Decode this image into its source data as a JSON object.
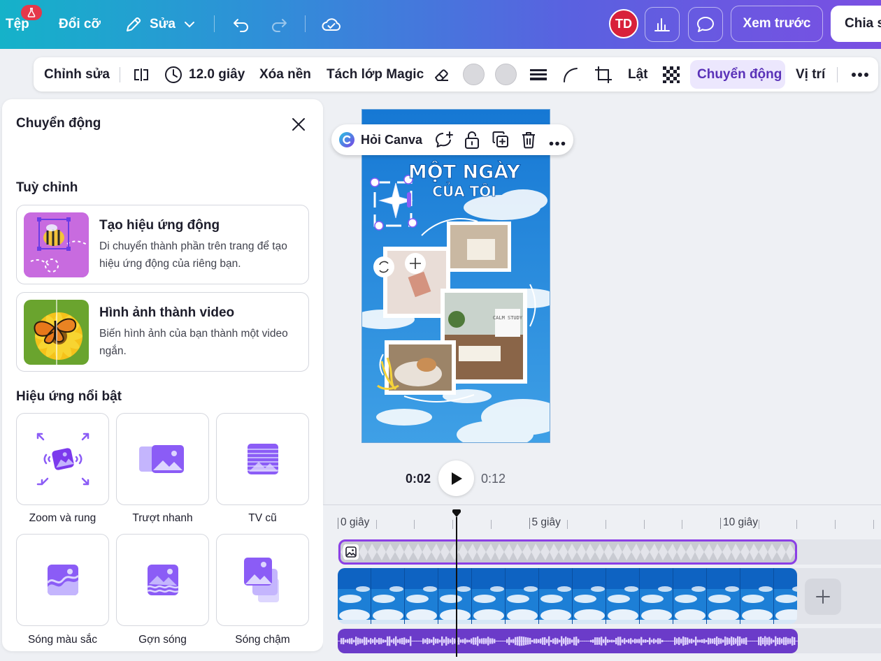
{
  "topbar": {
    "file_label": "Tệp",
    "resize_label": "Đổi cỡ",
    "edit_label": "Sửa",
    "avatar_initials": "TD",
    "preview_label": "Xem trước",
    "share_label": "Chia s"
  },
  "toolbar": {
    "edit_label": "Chỉnh sửa",
    "duration_label": "12.0 giây",
    "remove_bg_label": "Xóa nền",
    "magic_grab_label": "Tách lớp Magic",
    "flip_label": "Lật",
    "animate_label": "Chuyển động",
    "position_label": "Vị trí"
  },
  "panel": {
    "title": "Chuyển động",
    "customize_heading": "Tuỳ chỉnh",
    "cards": [
      {
        "title": "Tạo hiệu ứng động",
        "description": "Di chuyển thành phần trên trang để tạo hiệu ứng động của riêng bạn."
      },
      {
        "title": "Hình ảnh thành video",
        "description": "Biến hình ảnh của bạn thành một video ngắn."
      }
    ],
    "featured_heading": "Hiệu ứng nổi bật",
    "effects": [
      {
        "label": "Zoom và rung",
        "icon": "zoom-shake-icon"
      },
      {
        "label": "Trượt nhanh",
        "icon": "fast-slide-icon"
      },
      {
        "label": "TV cũ",
        "icon": "old-tv-icon"
      },
      {
        "label": "Sóng màu sắc",
        "icon": "color-wave-icon"
      },
      {
        "label": "Gợn sóng",
        "icon": "ripple-icon"
      },
      {
        "label": "Sóng chậm",
        "icon": "slow-wave-icon"
      }
    ]
  },
  "canvas": {
    "ask_canva_label": "Hỏi Canva",
    "design_title_line1": "MỘT NGÀY",
    "design_title_line2": "CỦA TÔI",
    "calm_study_text": "CALM STUDY"
  },
  "playback": {
    "current_time": "0:02",
    "total_time": "0:12"
  },
  "timeline": {
    "labels": [
      "0 giây",
      "5 giây",
      "10 giây"
    ],
    "playhead_seconds": 2,
    "total_seconds": 12
  },
  "colors": {
    "accent": "#7d2ae8",
    "active_pill": "#ece7fd",
    "avatar": "#d8213a",
    "audio_track": "#6b3bc9"
  }
}
